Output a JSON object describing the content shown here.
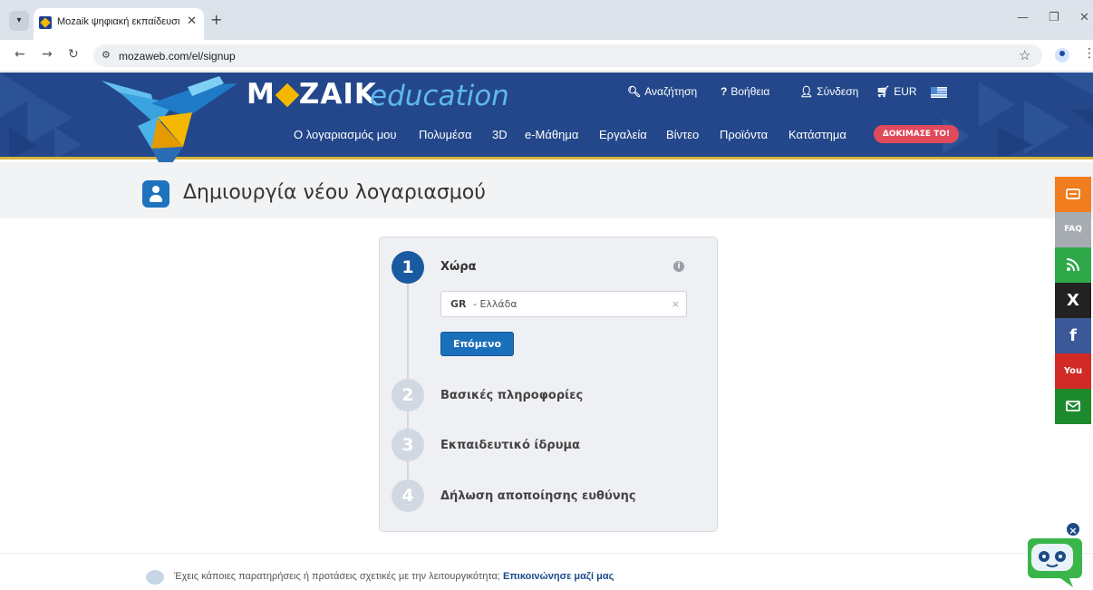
{
  "browser": {
    "tab_title": "Mozaik ψηφιακή εκπαίδευση κ...",
    "tab_close": "✕",
    "new_tab": "+",
    "url": "mozaweb.com/el/signup"
  },
  "header": {
    "brand_main": "M",
    "brand_rest": "ZAIK",
    "brand_sub": "education",
    "top_links": [
      {
        "icon": "🔍︎",
        "label": "Αναζήτηση"
      },
      {
        "icon": "?",
        "label": "Βοήθεια"
      },
      {
        "icon": "👤︎",
        "label": "Σύνδεση"
      },
      {
        "icon": "🛒︎",
        "label": "EUR"
      }
    ],
    "nav": [
      "Ο λογαριασμός μου",
      "Πολυμέσα",
      "3D",
      "e-Μάθημα",
      "Εργαλεία",
      "Βίντεο",
      "Προϊόντα",
      "Κατάστημα"
    ],
    "try_button": "ΔΟΚΙΜΑΣΕ ΤΟ!"
  },
  "page": {
    "title": "Δημιουργία νέου λογαριασμού"
  },
  "signup": {
    "steps": [
      {
        "number": "1",
        "label": "Χώρα",
        "state": "active"
      },
      {
        "number": "2",
        "label": "Βασικές πληροφορίες",
        "state": "inactive"
      },
      {
        "number": "3",
        "label": "Εκπαιδευτικό ίδρυμα",
        "state": "inactive"
      },
      {
        "number": "4",
        "label": "Δήλωση αποποίησης ευθύνης",
        "state": "inactive"
      }
    ],
    "info_icon": "i",
    "country_code": "GR",
    "country_name": " - Ελλάδα",
    "clear": "×",
    "next_button": "Επόμενο"
  },
  "footer": {
    "feedback_text": "Έχεις κάποιες παρατηρήσεις ή προτάσεις σχετικές με την λειτουργικότητα; ",
    "feedback_link": "Επικοινώνησε μαζί μας"
  },
  "social": {
    "faq": "FAQ",
    "x": "X",
    "facebook": "f",
    "youtube": "You",
    "colors": {
      "feedback": "#f07d1e",
      "faq": "#a7acb2",
      "rss": "#2fa84a",
      "x": "#222222",
      "facebook": "#3b5998",
      "youtube": "#d22b27",
      "mail": "#1e8a2e"
    }
  },
  "chatbot": {
    "close": "×"
  },
  "colors": {
    "header_bg": "#23478a",
    "primary": "#1a6fba",
    "accent": "#f5b800",
    "try_button": "#e04a5a"
  }
}
